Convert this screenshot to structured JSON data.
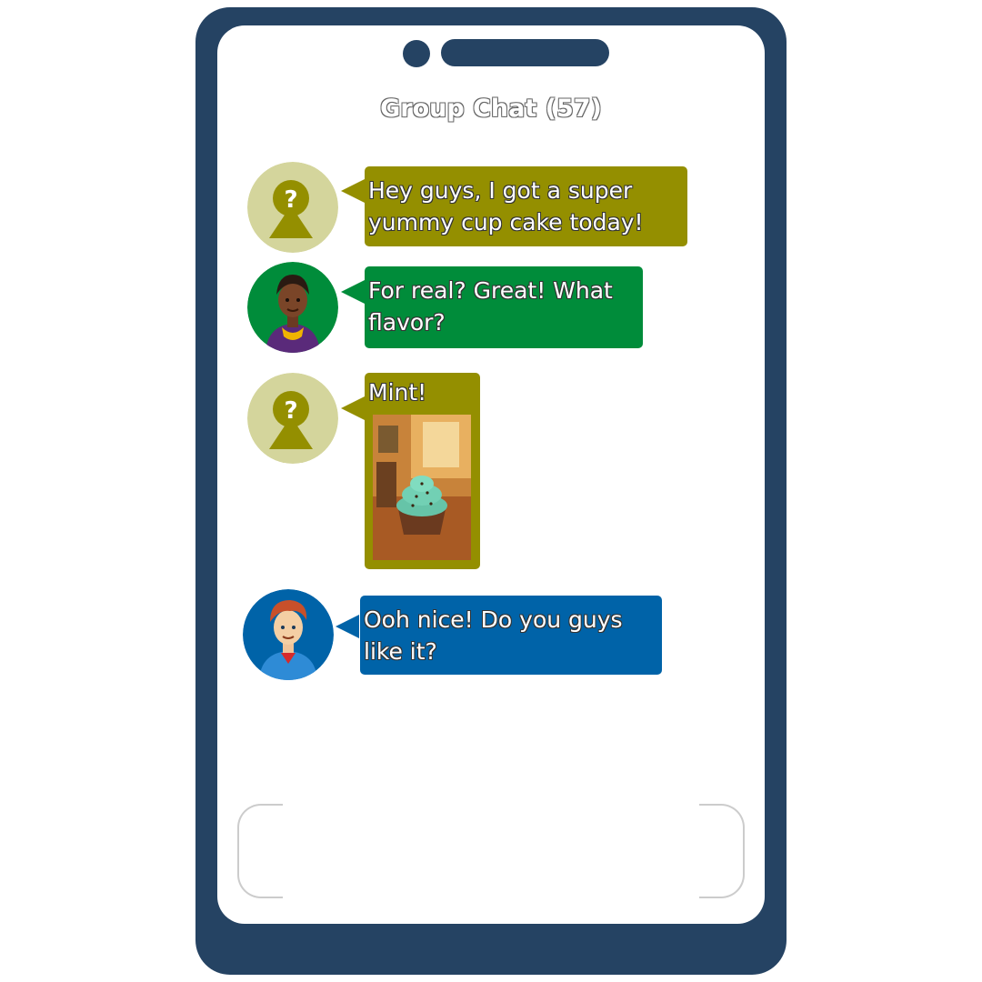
{
  "chat": {
    "title": "Group Chat (57)",
    "messages": [
      {
        "sender": "unknown",
        "text": "Hey guys, I got a super yummy cup cake today!",
        "color": "#948f00"
      },
      {
        "sender": "girl",
        "text": "For real? Great! What flavor?",
        "color": "#008c3a"
      },
      {
        "sender": "unknown",
        "text": "Mint!",
        "color": "#948f00",
        "attachment": "mint-cupcake-photo"
      },
      {
        "sender": "boy",
        "text": "Ooh nice! Do you guys like it?",
        "color": "#0063a8"
      }
    ]
  },
  "colors": {
    "phone_body": "#254363",
    "unknown_avatar_bg": "#d4d59c",
    "unknown_avatar_icon": "#948f00",
    "girl_avatar_bg": "#008c3a",
    "boy_avatar_bg": "#0063a8"
  },
  "icons": {
    "unknown_avatar": "question-person-icon",
    "camera": "camera-icon",
    "speaker": "speaker-icon"
  }
}
